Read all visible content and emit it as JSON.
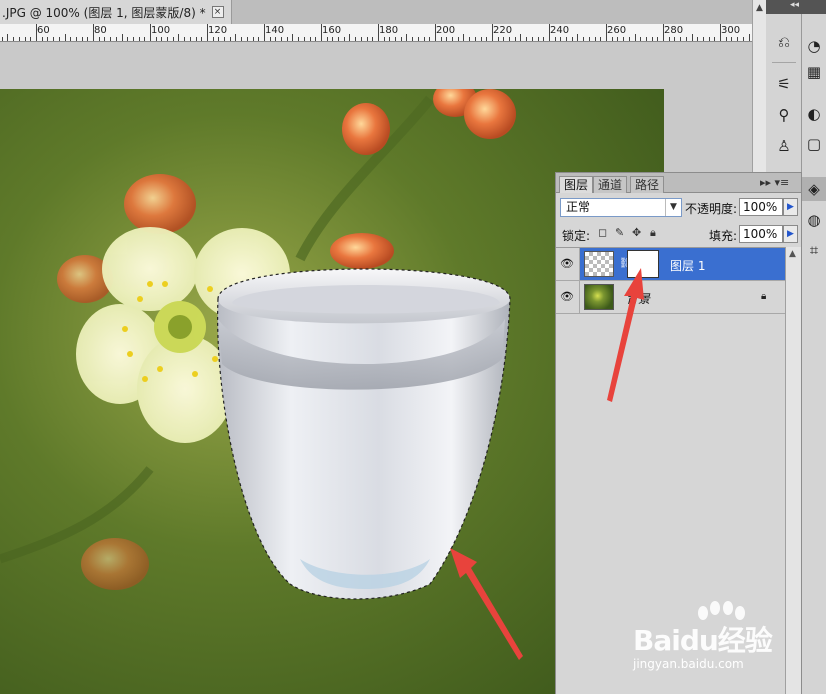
{
  "document_tab": {
    "title": ".JPG @ 100% (图层 1, 图层蒙版/8) *",
    "close": "×"
  },
  "ruler": {
    "labels": [
      "60",
      "80",
      "100",
      "120",
      "140",
      "160",
      "180",
      "200",
      "220",
      "240",
      "260",
      "280",
      "300"
    ]
  },
  "panel_toggle": "◂◂",
  "layers_panel": {
    "tabs": [
      "图层",
      "通道",
      "路径"
    ],
    "menu_glyphs": "▸▸ ▾≡",
    "blend_mode": "正常",
    "opacity_label": "不透明度:",
    "opacity_value": "100%",
    "lock_label": "锁定:",
    "fill_label": "填充:",
    "fill_value": "100%",
    "layers": [
      {
        "name": "图层 1",
        "selected": true
      },
      {
        "name": "背景",
        "selected": false
      }
    ]
  },
  "watermark": {
    "brand": "Baidu经验",
    "url": "jingyan.baidu.com"
  },
  "colors": {
    "selection": "#3a6fd0",
    "arrow": "#e8433c",
    "panel": "#d6d6d6"
  },
  "icons": [
    "eye-icon",
    "chain-icon",
    "lock-icon",
    "brush-icon",
    "move-icon",
    "transparency-lock-icon"
  ]
}
